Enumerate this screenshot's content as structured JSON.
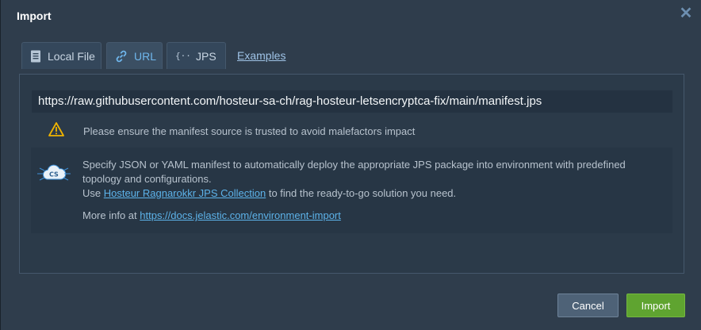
{
  "dialog": {
    "title": "Import",
    "close_icon": "close-icon"
  },
  "tabs": [
    {
      "label": "Local File",
      "icon": "file-icon",
      "active": false
    },
    {
      "label": "URL",
      "icon": "link-icon",
      "active": true
    },
    {
      "label": "JPS",
      "icon": "braces-icon",
      "active": false
    }
  ],
  "examples_link": "Examples",
  "url_field": {
    "value": "https://raw.githubusercontent.com/hosteur-sa-ch/rag-hosteur-letsencryptca-fix/main/manifest.jps"
  },
  "warning": {
    "icon": "warning-icon",
    "text": "Please ensure the manifest source is trusted to avoid malefactors impact"
  },
  "info": {
    "icon": "cs-icon",
    "line1": "Specify JSON or YAML manifest to automatically deploy the appropriate JPS package into environment with predefined topology and configurations.",
    "line2_prefix": "Use ",
    "line2_link": "Hosteur Ragnarokkr JPS Collection",
    "line2_suffix": " to find the ready-to-go solution you need.",
    "more_prefix": "More info at ",
    "more_link": "https://docs.jelastic.com/environment-import"
  },
  "buttons": {
    "cancel": "Cancel",
    "import": "Import"
  },
  "colors": {
    "accent": "#6fb6ec",
    "import_button": "#5fa430",
    "warning": "#f0b400"
  }
}
